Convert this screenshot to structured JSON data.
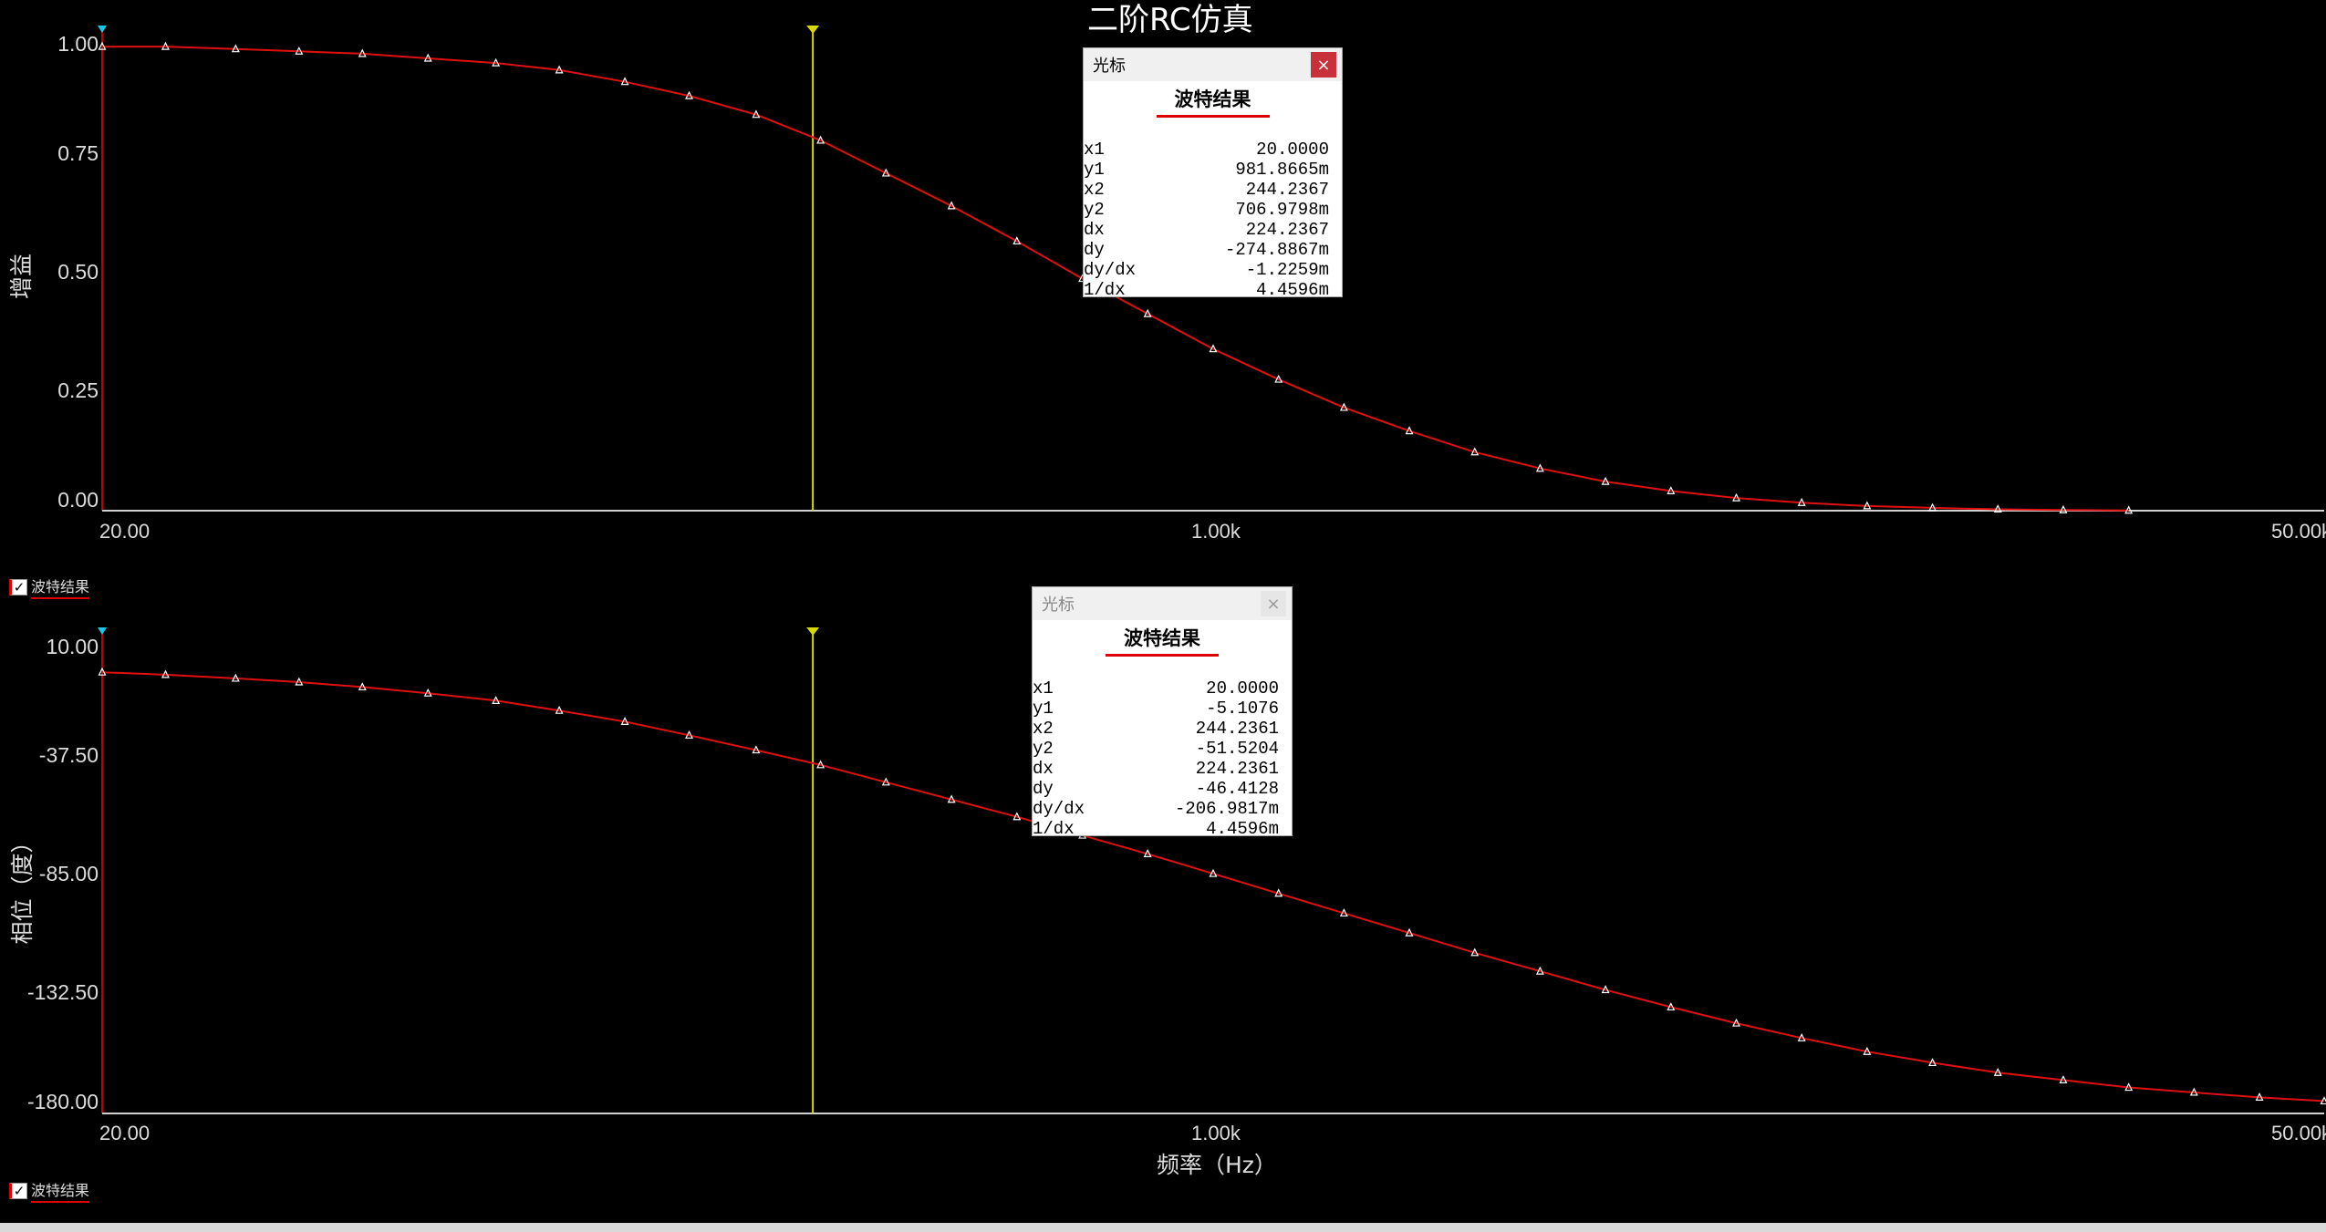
{
  "window": {
    "title": "二阶RC仿真"
  },
  "colors": {
    "trace": "#e01010",
    "cursor": "#d8d800",
    "cursor2_marker": "#18c8e8",
    "axis": "#d0d0d0",
    "background": "#000000"
  },
  "gain_plot": {
    "ylabel": "增益",
    "yticks": [
      "1.00",
      "0.75",
      "0.50",
      "0.25",
      "0.00"
    ],
    "xticks": [
      "20.00",
      "1.00k",
      "50.00k"
    ],
    "legend": "波特结果"
  },
  "phase_plot": {
    "ylabel": "相位（度）",
    "yticks": [
      "10.00",
      "-37.50",
      "-85.00",
      "-132.50",
      "-180.00"
    ],
    "xticks": [
      "20.00",
      "1.00k",
      "50.00k"
    ],
    "xlabel": "频率（Hz）",
    "legend": "波特结果"
  },
  "cursor_panel_gain": {
    "title": "光标",
    "close": "×",
    "trace_name": "波特结果",
    "rows": [
      {
        "k": "x1",
        "v": "20.0000"
      },
      {
        "k": "y1",
        "v": "981.8665m"
      },
      {
        "k": "x2",
        "v": "244.2367"
      },
      {
        "k": "y2",
        "v": "706.9798m"
      },
      {
        "k": "dx",
        "v": "224.2367"
      },
      {
        "k": "dy",
        "v": "-274.8867m"
      },
      {
        "k": "dy/dx",
        "v": "-1.2259m"
      },
      {
        "k": "1/dx",
        "v": "4.4596m"
      }
    ]
  },
  "cursor_panel_phase": {
    "title": "光标",
    "close": "×",
    "trace_name": "波特结果",
    "rows": [
      {
        "k": "x1",
        "v": "20.0000"
      },
      {
        "k": "y1",
        "v": "-5.1076"
      },
      {
        "k": "x2",
        "v": "244.2361"
      },
      {
        "k": "y2",
        "v": "-51.5204"
      },
      {
        "k": "dx",
        "v": "224.2361"
      },
      {
        "k": "dy",
        "v": "-46.4128"
      },
      {
        "k": "dy/dx",
        "v": "-206.9817m"
      },
      {
        "k": "1/dx",
        "v": "4.4596m"
      }
    ]
  },
  "chart_data": [
    {
      "type": "line",
      "title": "二阶RC仿真",
      "xlabel": "",
      "ylabel": "增益",
      "xscale": "log",
      "xlim": [
        20,
        50000
      ],
      "ylim": [
        0,
        1
      ],
      "grid": false,
      "cursors_x": [
        20,
        244.24
      ],
      "series": [
        {
          "name": "波特结果",
          "x": [
            20,
            25,
            32,
            40,
            50,
            63,
            80,
            100,
            126,
            158,
            200,
            251,
            316,
            398,
            501,
            631,
            794,
            1000,
            1259,
            1585,
            1995,
            2512,
            3162,
            3981,
            5012,
            6310,
            7943,
            10000,
            12589,
            15849,
            19953,
            25119
          ],
          "y": [
            0.99,
            0.99,
            0.985,
            0.98,
            0.975,
            0.965,
            0.955,
            0.94,
            0.915,
            0.885,
            0.845,
            0.79,
            0.72,
            0.65,
            0.575,
            0.495,
            0.42,
            0.345,
            0.28,
            0.22,
            0.17,
            0.125,
            0.09,
            0.062,
            0.042,
            0.027,
            0.017,
            0.01,
            0.006,
            0.003,
            0.0015,
            0.0005
          ]
        }
      ]
    },
    {
      "type": "line",
      "title": "",
      "xlabel": "频率（Hz）",
      "ylabel": "相位（度）",
      "xscale": "log",
      "xlim": [
        20,
        50000
      ],
      "ylim": [
        -180,
        10
      ],
      "grid": false,
      "cursors_x": [
        20,
        244.24
      ],
      "series": [
        {
          "name": "波特结果",
          "x": [
            20,
            25,
            32,
            40,
            50,
            63,
            80,
            100,
            126,
            158,
            200,
            251,
            316,
            398,
            501,
            631,
            794,
            1000,
            1259,
            1585,
            1995,
            2512,
            3162,
            3981,
            5012,
            6310,
            7943,
            10000,
            12589,
            15849,
            19953,
            25119,
            31623,
            39811,
            50000
          ],
          "y": [
            -1.5,
            -2.5,
            -4,
            -5.5,
            -7.5,
            -10,
            -13,
            -17,
            -21.5,
            -27,
            -33,
            -39,
            -46,
            -53,
            -60,
            -67.5,
            -75,
            -83,
            -91,
            -99,
            -107,
            -115,
            -122.5,
            -130,
            -137,
            -143.5,
            -149.5,
            -155,
            -159.5,
            -163.5,
            -166.5,
            -169.5,
            -171.5,
            -173.5,
            -175
          ]
        }
      ]
    }
  ]
}
